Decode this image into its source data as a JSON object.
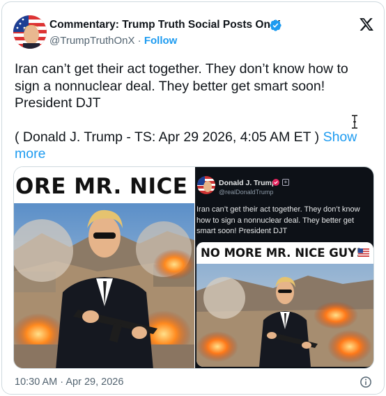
{
  "author": {
    "name": "Commentary: Trump Truth Social Posts On X",
    "handle": "@TrumpTruthOnX",
    "separator": " · ",
    "follow_label": "Follow"
  },
  "post": {
    "text_line1": "Iran can’t get their act together. They don’t know how to sign a nonnuclear deal. They better get smart soon! President DJT",
    "text_line2": "( Donald J. Trump - TS: Apr 29 2026, 4:05 AM ET ) ",
    "show_more_label": "Show more"
  },
  "media": {
    "left_banner": "ORE MR. NICE GU",
    "inner_post": {
      "name": "Donald J. Trump",
      "handle": "@realDonaldTrump",
      "text": "Iran can’t get their act together. They don’t know how to sign a nonnuclear deal. They better get smart soon! President DJT",
      "banner": "NO MORE MR. NICE GUY!"
    }
  },
  "footer": {
    "timestamp": "10:30 AM · Apr 29, 2026"
  },
  "colors": {
    "accent": "#1d9bf0",
    "text": "#0f1419",
    "muted": "#536471",
    "border": "#cfd9de"
  },
  "icons": {
    "verified": "verified-badge-icon",
    "x_logo": "x-logo-icon",
    "info": "info-icon",
    "cursor": "text-cursor-icon"
  }
}
